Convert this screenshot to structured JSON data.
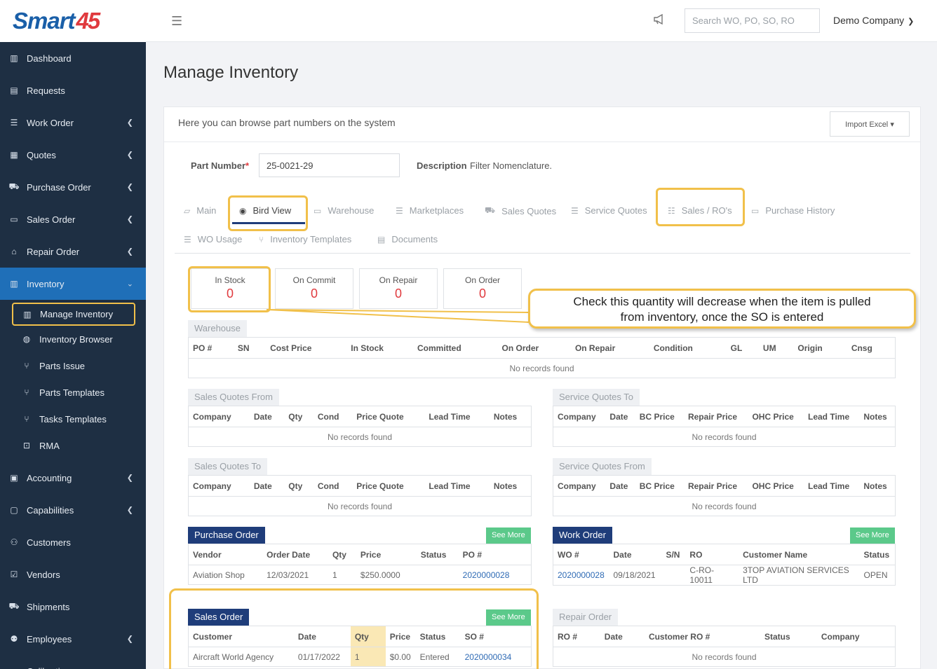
{
  "brand": {
    "part1": "Smart",
    "part2": "45"
  },
  "topbar": {
    "search_placeholder": "Search WO, PO, SO, RO",
    "company": "Demo Company"
  },
  "sidebar": {
    "items": [
      {
        "label": "Dashboard",
        "icon": "chart-icon",
        "chevron": false
      },
      {
        "label": "Requests",
        "icon": "document-icon",
        "chevron": false
      },
      {
        "label": "Work Order",
        "icon": "list-icon",
        "chevron": true
      },
      {
        "label": "Quotes",
        "icon": "clipboard-icon",
        "chevron": true
      },
      {
        "label": "Purchase Order",
        "icon": "cart-icon",
        "chevron": true
      },
      {
        "label": "Sales Order",
        "icon": "card-icon",
        "chevron": true
      },
      {
        "label": "Repair Order",
        "icon": "wrench-icon",
        "chevron": true
      },
      {
        "label": "Inventory",
        "icon": "warehouse-icon",
        "chevron": true,
        "active": true
      },
      {
        "label": "Accounting",
        "icon": "calculator-icon",
        "chevron": true
      },
      {
        "label": "Capabilities",
        "icon": "box-icon",
        "chevron": true
      },
      {
        "label": "Customers",
        "icon": "users-icon",
        "chevron": false
      },
      {
        "label": "Vendors",
        "icon": "check-square-icon",
        "chevron": false
      },
      {
        "label": "Shipments",
        "icon": "truck-icon",
        "chevron": false
      },
      {
        "label": "Employees",
        "icon": "employees-icon",
        "chevron": true
      },
      {
        "label": "Calibration",
        "icon": "gauge-icon",
        "chevron": false
      }
    ],
    "inventory_sub": [
      {
        "label": "Manage Inventory",
        "icon": "warehouse-icon",
        "current": true
      },
      {
        "label": "Inventory Browser",
        "icon": "globe-icon"
      },
      {
        "label": "Parts Issue",
        "icon": "branch-icon"
      },
      {
        "label": "Parts Templates",
        "icon": "branch-icon"
      },
      {
        "label": "Tasks Templates",
        "icon": "branch-icon"
      },
      {
        "label": "RMA",
        "icon": "dolly-icon"
      }
    ]
  },
  "page": {
    "title": "Manage Inventory",
    "subtitle": "Here you can browse part numbers on the system",
    "import_label": "Import Excel",
    "part_number_label": "Part Number",
    "required_mark": "*",
    "part_number_value": "25-0021-29",
    "description_label": "Description",
    "description_value": "Filter Nomenclature."
  },
  "tabs": [
    {
      "label": "Main",
      "icon": "folder-icon"
    },
    {
      "label": "Bird View",
      "icon": "eye-icon",
      "active": true
    },
    {
      "label": "Warehouse",
      "icon": "archive-icon"
    },
    {
      "label": "Marketplaces",
      "icon": "list-icon"
    },
    {
      "label": "Sales Quotes",
      "icon": "cart-icon"
    },
    {
      "label": "Service Quotes",
      "icon": "list-icon"
    },
    {
      "label": "Sales / RO's",
      "icon": "checklist-icon"
    },
    {
      "label": "Purchase History",
      "icon": "card-icon"
    },
    {
      "label": "WO Usage",
      "icon": "list-icon"
    },
    {
      "label": "Inventory Templates",
      "icon": "branch-icon"
    },
    {
      "label": "Documents",
      "icon": "document-icon"
    }
  ],
  "stats": [
    {
      "label": "In Stock",
      "value": "0"
    },
    {
      "label": "On Commit",
      "value": "0"
    },
    {
      "label": "On Repair",
      "value": "0"
    },
    {
      "label": "On Order",
      "value": "0"
    }
  ],
  "callout": {
    "line1": "Check this quantity will decrease when the item is pulled",
    "line2": "from inventory, once the SO is entered"
  },
  "no_records": "No records found",
  "see_more": "See More",
  "warehouse": {
    "title": "Warehouse",
    "columns": [
      "PO #",
      "SN",
      "Cost Price",
      "In Stock",
      "Committed",
      "On Order",
      "On Repair",
      "Condition",
      "GL",
      "UM",
      "Origin",
      "Cnsg"
    ]
  },
  "sales_quotes_from": {
    "title": "Sales Quotes From",
    "columns": [
      "Company",
      "Date",
      "Qty",
      "Cond",
      "Price Quote",
      "Lead Time",
      "Notes"
    ]
  },
  "service_quotes_to": {
    "title": "Service Quotes To",
    "columns": [
      "Company",
      "Date",
      "BC Price",
      "Repair Price",
      "OHC Price",
      "Lead Time",
      "Notes"
    ]
  },
  "sales_quotes_to": {
    "title": "Sales Quotes To",
    "columns": [
      "Company",
      "Date",
      "Qty",
      "Cond",
      "Price Quote",
      "Lead Time",
      "Notes"
    ]
  },
  "service_quotes_from": {
    "title": "Service Quotes From",
    "columns": [
      "Company",
      "Date",
      "BC Price",
      "Repair Price",
      "OHC Price",
      "Lead Time",
      "Notes"
    ]
  },
  "purchase_order": {
    "title": "Purchase Order",
    "columns": [
      "Vendor",
      "Order Date",
      "Qty",
      "Price",
      "Status",
      "PO #"
    ],
    "rows": [
      [
        "Aviation Shop",
        "12/03/2021",
        "1",
        "$250.0000",
        "",
        "2020000028"
      ]
    ]
  },
  "work_order": {
    "title": "Work Order",
    "columns": [
      "WO #",
      "Date",
      "S/N",
      "RO",
      "Customer Name",
      "Status"
    ],
    "rows": [
      [
        "2020000028",
        "09/18/2021",
        "",
        "C-RO-10011",
        "3TOP AVIATION SERVICES LTD",
        "OPEN"
      ]
    ]
  },
  "sales_order": {
    "title": "Sales Order",
    "columns": [
      "Customer",
      "Date",
      "Qty",
      "Price",
      "Status",
      "SO #"
    ],
    "rows": [
      [
        "Aircraft World Agency",
        "01/17/2022",
        "1",
        "$0.00",
        "Entered",
        "2020000034"
      ]
    ]
  },
  "repair_order": {
    "title": "Repair Order",
    "columns": [
      "RO #",
      "Date",
      "Customer RO #",
      "Status",
      "Company"
    ]
  },
  "colors": {
    "sidebar": "#1e2f43",
    "active": "#1f6fb8",
    "accent": "#1f3d7a",
    "highlight": "#f1c04a",
    "stat": "#e03a3e",
    "see_more": "#5bc98a"
  }
}
